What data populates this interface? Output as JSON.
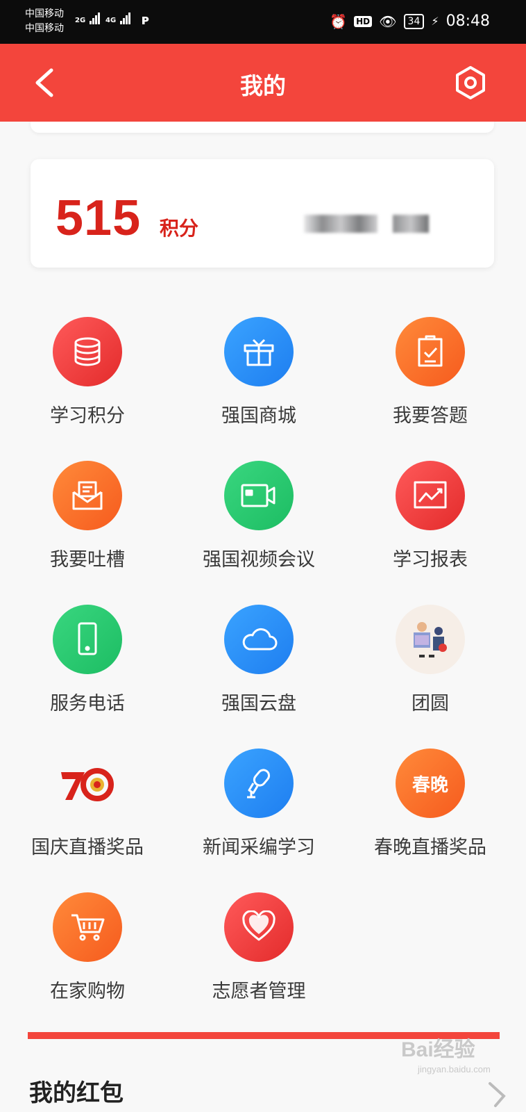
{
  "status_bar": {
    "carrier_1": "中国移动",
    "carrier_2": "中国移动",
    "signal_1": "2G",
    "signal_2": "4G",
    "battery": "34",
    "time": "08:48"
  },
  "header": {
    "title": "我的",
    "back_icon": "chevron-left-icon",
    "settings_icon": "hexagon-settings-icon"
  },
  "points": {
    "value": "515",
    "unit": "积分",
    "accent_color": "#d8231b"
  },
  "menu": [
    {
      "label": "学习积分",
      "icon": "database-icon",
      "color": "red"
    },
    {
      "label": "强国商城",
      "icon": "gift-icon",
      "color": "blue"
    },
    {
      "label": "我要答题",
      "icon": "clipboard-check-icon",
      "color": "orange"
    },
    {
      "label": "我要吐槽",
      "icon": "envelope-icon",
      "color": "orange"
    },
    {
      "label": "强国视频会议",
      "icon": "video-camera-icon",
      "color": "green"
    },
    {
      "label": "学习报表",
      "icon": "chart-icon",
      "color": "red"
    },
    {
      "label": "服务电话",
      "icon": "phone-icon",
      "color": "green"
    },
    {
      "label": "强国云盘",
      "icon": "cloud-icon",
      "color": "blue"
    },
    {
      "label": "团圆",
      "icon": "family-illustration-icon",
      "color": "cream"
    },
    {
      "label": "国庆直播奖品",
      "icon": "seventy-logo-icon",
      "color": "none"
    },
    {
      "label": "新闻采编学习",
      "icon": "microphone-icon",
      "color": "blue"
    },
    {
      "label": "春晚直播奖品",
      "icon": "spring-gala-icon",
      "color": "orange",
      "badge_text": "春晚"
    },
    {
      "label": "在家购物",
      "icon": "shopping-cart-icon",
      "color": "orange"
    },
    {
      "label": "志愿者管理",
      "icon": "heart-icon",
      "color": "red"
    }
  ],
  "section": {
    "title": "我的红包"
  },
  "watermark": {
    "text": "Bai经验",
    "sub": "jingyan.baidu.com"
  },
  "colors": {
    "header_bg": "#f3453c",
    "status_bar_bg": "#0c0c0c"
  }
}
